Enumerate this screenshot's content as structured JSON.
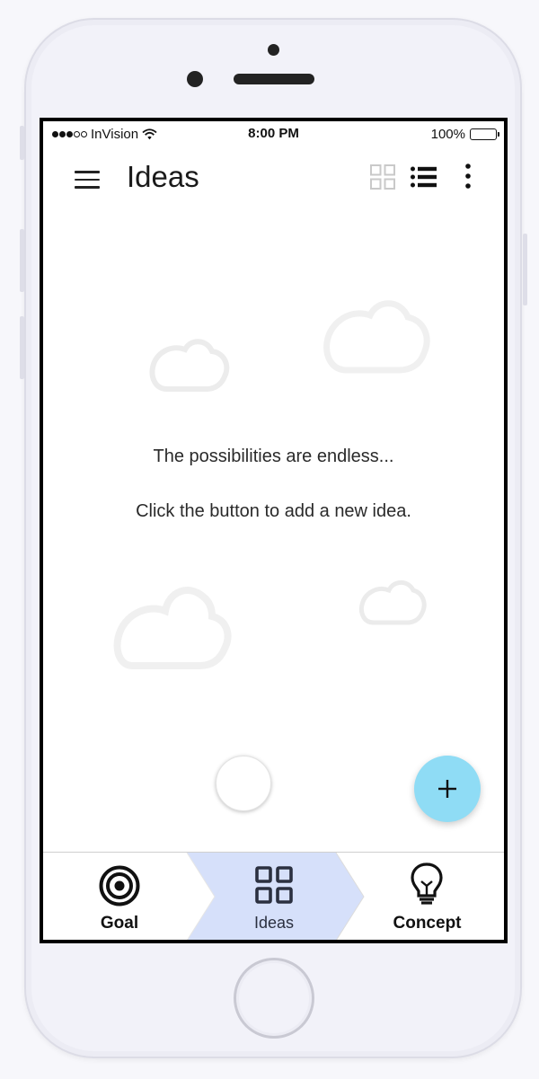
{
  "status_bar": {
    "carrier": "InVision",
    "time": "8:00 PM",
    "battery": "100%"
  },
  "app_bar": {
    "title": "Ideas",
    "icons": [
      "menu-icon",
      "grid-view-icon",
      "list-view-icon",
      "more-vert-icon"
    ]
  },
  "empty_state": {
    "line1": "The possibilities are endless...",
    "line2": "Click the button to add a new idea."
  },
  "fab": {
    "icon": "plus-icon",
    "color": "#8fdcf5"
  },
  "bottom_nav": {
    "active": "Ideas",
    "active_color": "#d6e0fa",
    "items": [
      {
        "label": "Goal",
        "icon": "target-icon"
      },
      {
        "label": "Ideas",
        "icon": "grid-icon"
      },
      {
        "label": "Concept",
        "icon": "lightbulb-icon"
      }
    ]
  }
}
